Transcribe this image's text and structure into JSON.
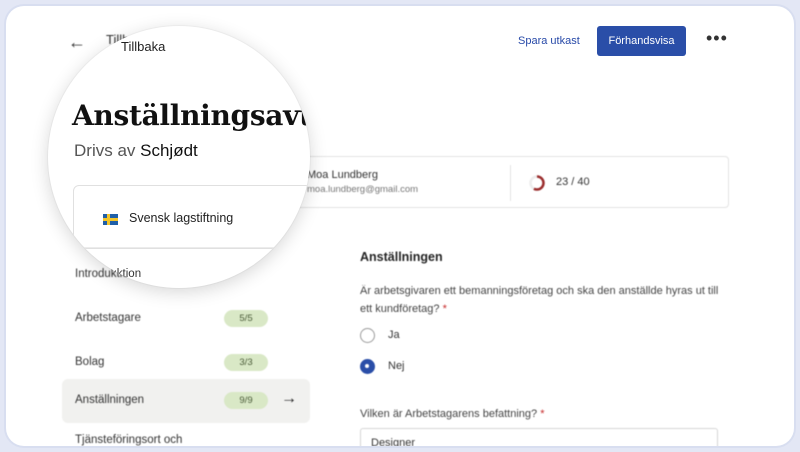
{
  "header": {
    "back_label": "Tillbaka",
    "save_draft_label": "Spara utkast",
    "preview_label": "Förhandsvisa",
    "more_label": "•••"
  },
  "document": {
    "title": "Anställningsavtal",
    "powered_by_prefix": "Drivs av",
    "powered_by_brand": "Schjødt",
    "foundation_label": "Svensk lagstiftning"
  },
  "user": {
    "name": "Moa Lundberg",
    "email": "moa.lundberg@gmail.com",
    "progress_text": "23 / 40",
    "progress_fraction": 0.575,
    "progress_color": "#9b2d2d"
  },
  "sidebar": {
    "items": [
      {
        "label": "Introduktion",
        "badge": ""
      },
      {
        "label": "Arbetstagare",
        "badge": "5/5"
      },
      {
        "label": "Bolag",
        "badge": "3/3"
      },
      {
        "label": "Anställningen",
        "badge": "9/9",
        "active": true
      },
      {
        "label": "Tjänsteföringsort och",
        "badge": ""
      }
    ]
  },
  "form": {
    "section_title": "Anställningen",
    "question": "Är arbetsgivaren ett bemanningsföretag och ska den anställde hyras ut till ett kundföretag?",
    "required_mark": "*",
    "options": [
      {
        "label": "Ja",
        "selected": false
      },
      {
        "label": "Nej",
        "selected": true
      }
    ],
    "position_question": "Vilken är Arbetstagarens befattning?",
    "position_value": "Designer"
  },
  "colors": {
    "primary": "#2a4ea8",
    "badge_bg": "#d9e8c6",
    "active_bg": "#f1f1ef"
  }
}
